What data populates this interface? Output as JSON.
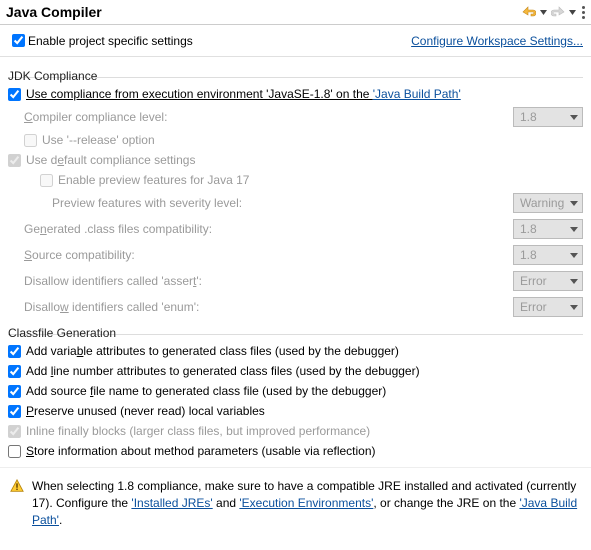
{
  "header": {
    "title": "Java Compiler"
  },
  "topRow": {
    "enableProjectSpecific": "Enable project specific settings",
    "configureLink": "Configure Workspace Settings..."
  },
  "jdk": {
    "groupLabel": "JDK Compliance",
    "useCompliancePrefix": "Use compliance from execution environment 'JavaSE-1.8' on the ",
    "javaBuildPathLink": "'Java Build Path'",
    "compilerLevelLabel": "Compiler compliance level:",
    "compilerLevelValue": "1.8",
    "useReleaseLabel": "Use '--release' option",
    "useDefaultLabel": "Use default compliance settings",
    "enablePreviewLabel": "Enable preview features for Java 17",
    "previewSeverityLabel": "Preview features with severity level:",
    "previewSeverityValue": "Warning",
    "generatedClassLabel": "Generated .class files compatibility:",
    "generatedClassValue": "1.8",
    "sourceCompatLabel": "Source compatibility:",
    "sourceCompatValue": "1.8",
    "disallowAssertLabel": "Disallow identifiers called 'assert':",
    "disallowAssertValue": "Error",
    "disallowEnumLabel": "Disallow identifiers called 'enum':",
    "disallowEnumValue": "Error"
  },
  "classfile": {
    "groupLabel": "Classfile Generation",
    "addVarAttr": "Add variable attributes to generated class files (used by the debugger)",
    "addLineNum": "Add line number attributes to generated class files (used by the debugger)",
    "addSourceFile": "Add source file name to generated class file (used by the debugger)",
    "preserveUnused": "Preserve unused (never read) local variables",
    "inlineFinally": "Inline finally blocks (larger class files, but improved performance)",
    "storeMethodParams": "Store information about method parameters (usable via reflection)"
  },
  "warning": {
    "t1": "When selecting 1.8 compliance, make sure to have a compatible JRE installed and activated (currently 17). Configure the ",
    "link1": "'Installed JREs'",
    "t2": " and ",
    "link2": "'Execution Environments'",
    "t3": ", or change the JRE on the ",
    "link3": "'Java Build Path'",
    "t4": "."
  }
}
